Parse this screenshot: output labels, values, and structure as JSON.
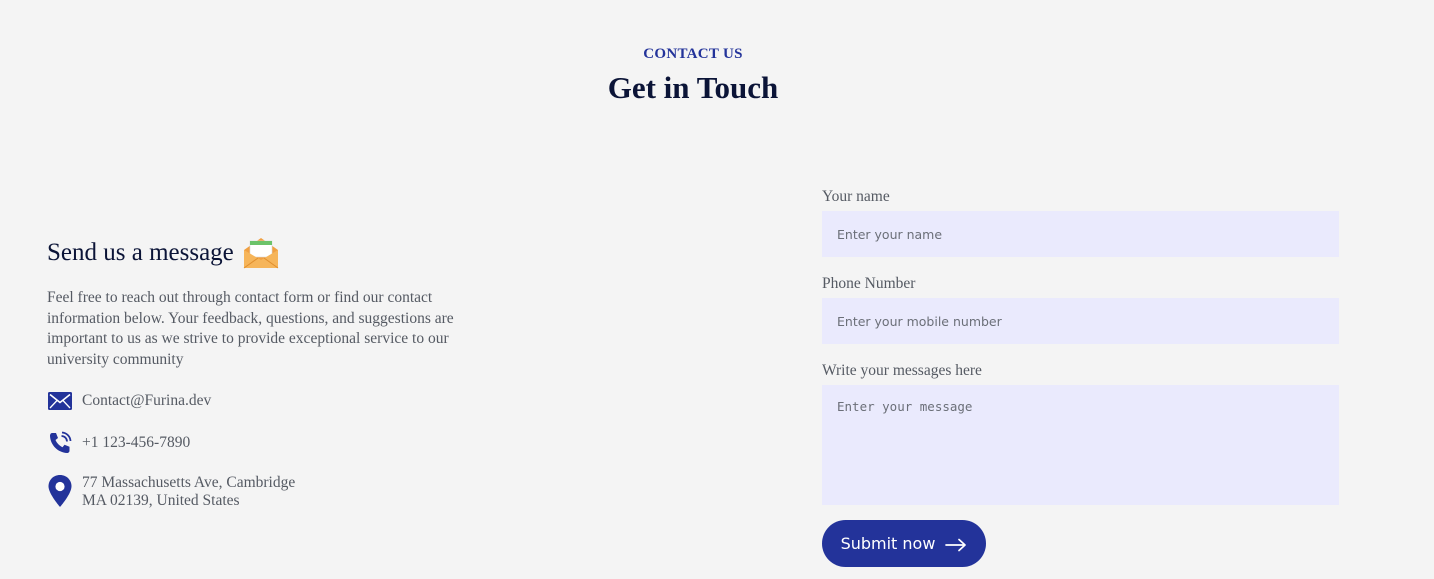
{
  "header": {
    "eyebrow": "CONTACT US",
    "title": "Get in Touch"
  },
  "info": {
    "heading": "Send us a message",
    "heading_icon": "envelope-open-icon",
    "description": "Feel free to reach out through contact form or find our contact information below. Your feedback, questions, and suggestions are important to us as we strive to provide exceptional service to our university community",
    "email": "Contact@Furina.dev",
    "phone": "+1 123-456-7890",
    "address_line1": "77 Massachusetts Ave, Cambridge",
    "address_line2": "MA 02139, United States"
  },
  "form": {
    "name_label": "Your name",
    "name_placeholder": "Enter your name",
    "phone_label": "Phone Number",
    "phone_placeholder": "Enter your mobile number",
    "message_label": "Write your messages here",
    "message_placeholder": "Enter your message",
    "submit_label": "Submit now"
  },
  "colors": {
    "accent": "#23339a",
    "heading": "#0b1437",
    "field_bg": "#eaeafd",
    "page_bg": "#f4f4f4"
  }
}
